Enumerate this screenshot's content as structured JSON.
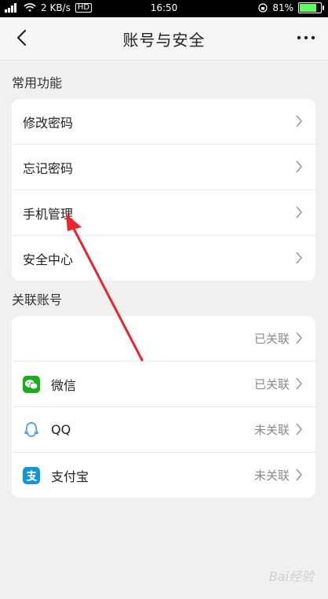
{
  "status_bar": {
    "network": "2 KB/s",
    "hd_badge": "HD",
    "time": "16:50",
    "battery_percent": "81%",
    "battery_level": 0.81
  },
  "header": {
    "title": "账号与安全",
    "back_icon": "chevron-left-icon",
    "more_icon": "more-horizontal-icon"
  },
  "sections": {
    "common": {
      "label": "常用功能",
      "items": [
        {
          "label": "修改密码"
        },
        {
          "label": "忘记密码"
        },
        {
          "label": "手机管理"
        },
        {
          "label": "安全中心"
        }
      ]
    },
    "linked": {
      "label": "关联账号",
      "items": [
        {
          "label": "",
          "status": "已关联",
          "icon": ""
        },
        {
          "label": "微信",
          "status": "已关联",
          "icon": "wechat-icon",
          "color": "#1aad19"
        },
        {
          "label": "QQ",
          "status": "未关联",
          "icon": "qq-icon",
          "color": "#4a9ff5"
        },
        {
          "label": "支付宝",
          "status": "未关联",
          "icon": "alipay-icon",
          "color": "#1296db"
        }
      ]
    }
  },
  "annotation": {
    "arrow_color": "#e8262b"
  },
  "watermark": "Bai经验"
}
